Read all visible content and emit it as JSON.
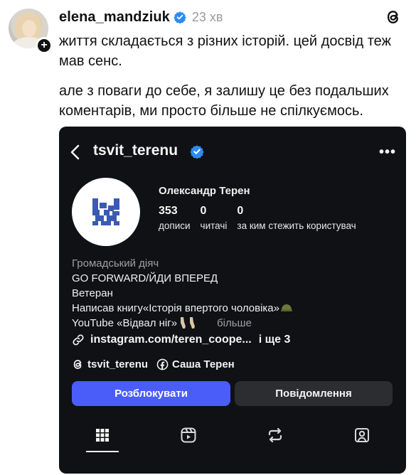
{
  "post": {
    "username": "elena_mandziuk",
    "timestamp": "23 хв",
    "text_paragraph_1": "життя складається з різних історій. цей досвід теж мав сенс.",
    "text_paragraph_2": "але з поваги до себе, я залишу це без подальших коментарів, ми просто більше не спілкуємось."
  },
  "profile_card": {
    "username": "tsvit_terenu",
    "full_name": "Олександр Терен",
    "stats": [
      {
        "value": "353",
        "label": "дописи"
      },
      {
        "value": "0",
        "label": "читачі"
      },
      {
        "value": "0",
        "label": "за ким стежить користувач"
      }
    ],
    "bio": {
      "category": "Громадський діяч",
      "line_1": "GO FORWARD/ЙДИ ВПЕРЕД",
      "line_2": "Ветеран",
      "line_3": "Написав книгу«Історія впертого чоловіка»",
      "line_4": "YouTube «Відвал ніг»",
      "more": "більше"
    },
    "link": {
      "url": "instagram.com/teren_coope...",
      "extra": "і ще 3"
    },
    "social": {
      "threads_handle": "tsvit_terenu",
      "facebook_name": "Саша Терен"
    },
    "buttons": {
      "unblock": "Розблокувати",
      "message": "Повідомлення"
    },
    "tabs": [
      {
        "icon": "grid-icon",
        "active": true
      },
      {
        "icon": "reels-icon",
        "active": false
      },
      {
        "icon": "repost-icon",
        "active": false
      },
      {
        "icon": "tagged-icon",
        "active": false
      }
    ]
  },
  "colors": {
    "verified_blue": "#2e8bf0",
    "card_background": "#101114",
    "primary_button": "#4a5df9",
    "secondary_button": "#2b2d31",
    "muted_text": "#9ba0a8",
    "logo_blue": "#3b5bb0"
  }
}
